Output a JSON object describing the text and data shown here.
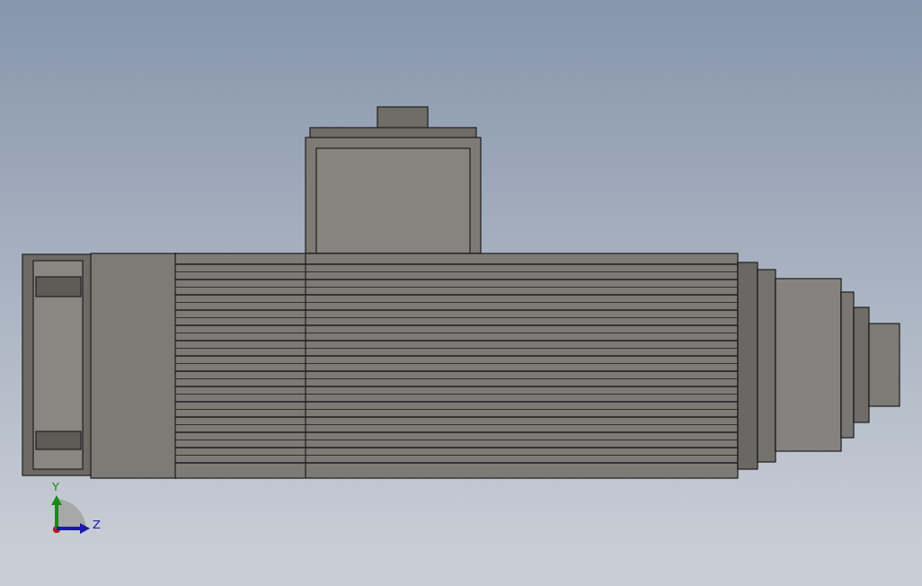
{
  "viewport": {
    "triad": {
      "axes": [
        {
          "label": "Y",
          "color": "#1a8a1a"
        },
        {
          "label": "Z",
          "color": "#1a1aa8"
        }
      ]
    }
  }
}
